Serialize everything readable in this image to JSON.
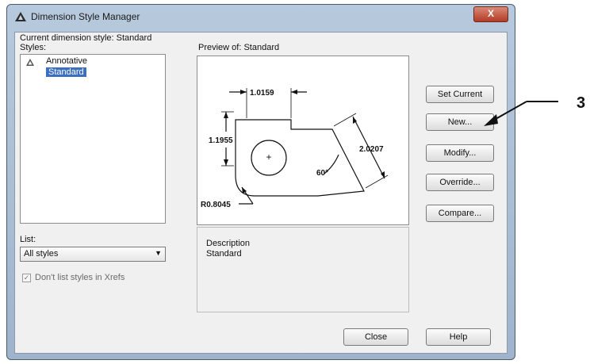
{
  "window": {
    "title": "Dimension Style Manager",
    "close_label": "X"
  },
  "current_style": "Current dimension style: Standard",
  "styles": {
    "label": "Styles:",
    "items": [
      "Annotative",
      "Standard"
    ],
    "selected": "Standard",
    "annotative_icon": "triangle-icon"
  },
  "preview": {
    "label": "Preview of: Standard",
    "dims": {
      "horizontal": "1.0159",
      "vertical": "1.1955",
      "aligned": "2.0207",
      "angle": "60°",
      "radius": "R0.8045"
    }
  },
  "list": {
    "label": "List:",
    "value": "All styles",
    "xrefs_checkbox_label": "Don't list styles in Xrefs",
    "xrefs_checked": true
  },
  "description": {
    "label": "Description",
    "text": "Standard"
  },
  "buttons": {
    "set_current": "Set Current",
    "new": "New...",
    "modify": "Modify...",
    "override": "Override...",
    "compare": "Compare...",
    "close": "Close",
    "help": "Help"
  },
  "callout": {
    "number": "3"
  }
}
